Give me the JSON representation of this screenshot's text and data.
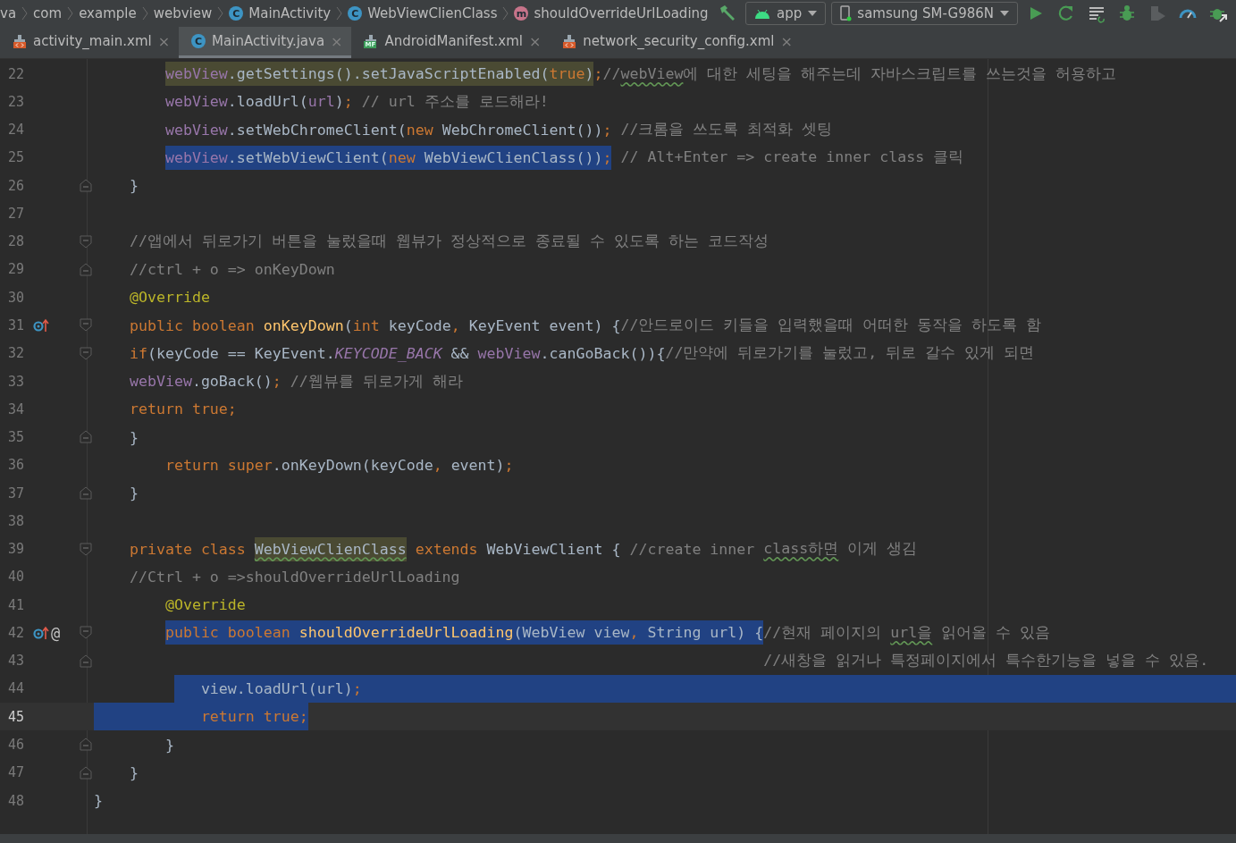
{
  "breadcrumbs": [
    {
      "label": "va",
      "kind": "package"
    },
    {
      "label": "com",
      "kind": "package"
    },
    {
      "label": "example",
      "kind": "package"
    },
    {
      "label": "webview",
      "kind": "package"
    },
    {
      "label": "MainActivity",
      "kind": "class",
      "badge": "C"
    },
    {
      "label": "WebViewClienClass",
      "kind": "class",
      "badge": "C"
    },
    {
      "label": "shouldOverrideUrlLoading",
      "kind": "method",
      "badge": "m"
    }
  ],
  "toolbar": {
    "run_config": "app",
    "device": "samsung SM-G986N"
  },
  "tabs": [
    {
      "label": "activity_main.xml",
      "kind": "layout",
      "selected": false,
      "close": "×"
    },
    {
      "label": "MainActivity.java",
      "kind": "class",
      "badge": "C",
      "selected": true,
      "close": "×"
    },
    {
      "label": "AndroidManifest.xml",
      "kind": "manifest",
      "badge": "MF",
      "selected": false,
      "close": "×"
    },
    {
      "label": "network_security_config.xml",
      "kind": "layout",
      "selected": false,
      "close": "×"
    }
  ],
  "lines": [
    {
      "num": "22",
      "current": false,
      "indent": {
        "kind": "method"
      },
      "kind": "plain",
      "tokens": [
        {
          "t": "webView",
          "kind": "field",
          "hl": true
        },
        {
          "t": ".getSettings().setJavaScriptEnabled(",
          "kind": "plain",
          "hl": true
        },
        {
          "t": "true",
          "kind": "kw",
          "hl": true
        },
        {
          "t": ")",
          "kind": "plain",
          "hl": true
        },
        {
          "t": ";",
          "kind": "kw"
        },
        {
          "t": "//",
          "kind": "comment"
        },
        {
          "t": "webView",
          "kind": "comment",
          "typo": true
        },
        {
          "t": "에 대한 세팅을 해주는데 자바스크립트를 쓰는것을 허용하고",
          "kind": "comment"
        }
      ]
    },
    {
      "num": "23",
      "current": false,
      "indent": {
        "kind": "method"
      },
      "kind": "plain",
      "tokens": [
        {
          "t": "webView",
          "kind": "field"
        },
        {
          "t": ".loadUrl(",
          "kind": "plain"
        },
        {
          "t": "url",
          "kind": "field"
        },
        {
          "t": ")",
          "kind": "plain"
        },
        {
          "t": ";",
          "kind": "kw"
        },
        {
          "t": " // url 주소를 로드해라!",
          "kind": "comment"
        }
      ]
    },
    {
      "num": "24",
      "current": false,
      "indent": {
        "kind": "method"
      },
      "kind": "plain",
      "tokens": [
        {
          "t": "webView",
          "kind": "field"
        },
        {
          "t": ".setWebChromeClient(",
          "kind": "plain"
        },
        {
          "t": "new",
          "kind": "kw"
        },
        {
          "t": " WebChromeClient())",
          "kind": "plain"
        },
        {
          "t": ";",
          "kind": "kw"
        },
        {
          "t": " //크롬을 쓰도록 최적화 셋팅",
          "kind": "comment"
        }
      ]
    },
    {
      "num": "25",
      "current": false,
      "indent": {
        "kind": "method"
      },
      "kind": "partial-selection",
      "tokens": [
        {
          "t": "webView",
          "kind": "field",
          "selected": true
        },
        {
          "t": ".setWebViewClient(",
          "kind": "plain",
          "selected": true
        },
        {
          "t": "new",
          "kind": "kw",
          "selected": true
        },
        {
          "t": " WebViewClienClass())",
          "kind": "plain",
          "selected": true
        },
        {
          "t": ";",
          "kind": "kw",
          "selected": true
        },
        {
          "t": " // Alt+Enter => create inner class 클릭",
          "kind": "comment",
          "selected": false
        }
      ]
    },
    {
      "num": "26",
      "current": false,
      "fold_end": true,
      "indent": {
        "kind": "class"
      },
      "kind": "plain",
      "tokens": [
        {
          "t": "}",
          "kind": "plain"
        }
      ]
    },
    {
      "num": "27",
      "current": false,
      "kind": "plain"
    },
    {
      "num": "28",
      "current": false,
      "fold_start": true,
      "indent": {
        "kind": "class"
      },
      "kind": "plain",
      "tokens": [
        {
          "t": "//앱에서 뒤로가기 버튼을 눌렀을때 웹뷰가 정상적으로 종료될 수 있도록 하는 코드작성",
          "kind": "comment"
        }
      ]
    },
    {
      "num": "29",
      "current": false,
      "fold_end": true,
      "indent": {
        "kind": "class"
      },
      "kind": "plain",
      "tokens": [
        {
          "t": "//ctrl + o => onKeyDown",
          "kind": "comment"
        }
      ]
    },
    {
      "num": "30",
      "current": false,
      "indent": {
        "kind": "class"
      },
      "kind": "plain",
      "tokens": [
        {
          "t": "@Override",
          "kind": "annot"
        }
      ]
    },
    {
      "num": "31",
      "current": false,
      "override": true,
      "fold_start": true,
      "indent": {
        "kind": "class"
      },
      "kind": "plain",
      "tokens": [
        {
          "t": "public boolean ",
          "kind": "kw"
        },
        {
          "t": "onKeyDown",
          "kind": "method"
        },
        {
          "t": "(",
          "kind": "plain"
        },
        {
          "t": "int",
          "kind": "kw"
        },
        {
          "t": " keyCode",
          "kind": "plain"
        },
        {
          "t": ",",
          "kind": "kw"
        },
        {
          "t": " KeyEvent event) {",
          "kind": "plain"
        },
        {
          "t": "//안드로이드 키들을 입력했을때 어떠한 동작을 하도록 함",
          "kind": "comment"
        }
      ]
    },
    {
      "num": "32",
      "current": false,
      "fold_start": true,
      "indent": {
        "kind": "class"
      },
      "kind": "plain",
      "tokens": [
        {
          "t": "if",
          "kind": "kw"
        },
        {
          "t": "(keyCode == KeyEvent.",
          "kind": "plain"
        },
        {
          "t": "KEYCODE_BACK",
          "kind": "static"
        },
        {
          "t": " && ",
          "kind": "plain"
        },
        {
          "t": "webView",
          "kind": "field"
        },
        {
          "t": ".canGoBack()){",
          "kind": "plain"
        },
        {
          "t": "//만약에 뒤로가기를 눌렀고, 뒤로 갈수 있게 되면",
          "kind": "comment"
        }
      ]
    },
    {
      "num": "33",
      "current": false,
      "indent": {
        "kind": "class"
      },
      "kind": "plain",
      "tokens": [
        {
          "t": "webView",
          "kind": "field"
        },
        {
          "t": ".goBack()",
          "kind": "plain"
        },
        {
          "t": ";",
          "kind": "kw"
        },
        {
          "t": " //웹뷰를 뒤로가게 해라",
          "kind": "comment"
        }
      ]
    },
    {
      "num": "34",
      "current": false,
      "indent": {
        "kind": "class"
      },
      "kind": "plain",
      "tokens": [
        {
          "t": "return true;",
          "kind": "kw"
        }
      ]
    },
    {
      "num": "35",
      "current": false,
      "fold_end": true,
      "indent": {
        "kind": "class"
      },
      "kind": "plain",
      "tokens": [
        {
          "t": "}",
          "kind": "plain"
        }
      ]
    },
    {
      "num": "36",
      "current": false,
      "indent": {
        "kind": "method"
      },
      "kind": "plain",
      "tokens": [
        {
          "t": "return super",
          "kind": "kw"
        },
        {
          "t": ".onKeyDown(keyCode",
          "kind": "plain"
        },
        {
          "t": ",",
          "kind": "kw"
        },
        {
          "t": " event)",
          "kind": "plain"
        },
        {
          "t": ";",
          "kind": "kw"
        }
      ]
    },
    {
      "num": "37",
      "current": false,
      "fold_end": true,
      "indent": {
        "kind": "class"
      },
      "kind": "plain",
      "tokens": [
        {
          "t": "}",
          "kind": "plain"
        }
      ]
    },
    {
      "num": "38",
      "current": false,
      "kind": "plain"
    },
    {
      "num": "39",
      "current": false,
      "fold_start": true,
      "indent": {
        "kind": "class"
      },
      "kind": "plain",
      "tokens": [
        {
          "t": "private class ",
          "kind": "kw"
        },
        {
          "t": "WebViewClienClass",
          "kind": "plain",
          "hl": true,
          "typo": true
        },
        {
          "t": " extends ",
          "kind": "kw"
        },
        {
          "t": "WebViewClient { ",
          "kind": "plain"
        },
        {
          "t": "//create inner ",
          "kind": "comment"
        },
        {
          "t": "class하면",
          "kind": "comment",
          "typo": true
        },
        {
          "t": " 이게 생김",
          "kind": "comment"
        }
      ]
    },
    {
      "num": "40",
      "current": false,
      "indent": {
        "kind": "class"
      },
      "kind": "plain",
      "tokens": [
        {
          "t": "//Ctrl + o =>shouldOverrideUrlLoading",
          "kind": "comment"
        }
      ]
    },
    {
      "num": "41",
      "current": false,
      "indent": {
        "kind": "method"
      },
      "kind": "plain",
      "tokens": [
        {
          "t": "@Override",
          "kind": "annot"
        }
      ]
    },
    {
      "num": "42",
      "current": false,
      "override": true,
      "gutter_text": "@",
      "fold_start": true,
      "indent": {
        "kind": "method"
      },
      "kind": "partial-selection",
      "tokens": [
        {
          "t": "public boolean ",
          "kind": "kw",
          "selected": true
        },
        {
          "t": "shouldOverrideUrlLoading",
          "kind": "method",
          "selected": true
        },
        {
          "t": "(WebView view",
          "kind": "plain",
          "selected": true
        },
        {
          "t": ",",
          "kind": "kw",
          "selected": true
        },
        {
          "t": " String url) {",
          "kind": "plain",
          "selected": true
        },
        {
          "t": "//현재 페이지의 ",
          "kind": "comment",
          "selected": false
        },
        {
          "t": "url을",
          "kind": "comment",
          "typo": true,
          "selected": false
        },
        {
          "t": " 읽어올 수 있음",
          "kind": "comment",
          "selected": false
        }
      ]
    },
    {
      "num": "43",
      "current": false,
      "fold_end": true,
      "indent": {
        "kind": "aligned"
      },
      "kind": "plain",
      "tokens": [
        {
          "t": "//새창을 읽거나 특정페이지에서 특수한기능을 넣을 수 있음.",
          "kind": "comment"
        }
      ]
    },
    {
      "num": "44",
      "current": false,
      "indent": {
        "kind": "statement"
      },
      "kind": "selection-to-end",
      "tokens": [
        {
          "t": "view.loadUrl(url)",
          "kind": "plain"
        },
        {
          "t": ";",
          "kind": "kw"
        }
      ]
    },
    {
      "num": "45",
      "current": true,
      "indent": {
        "kind": "statement"
      },
      "kind": "selection-from-edge",
      "tokens": [
        {
          "t": "return true;",
          "kind": "kw"
        }
      ]
    },
    {
      "num": "46",
      "current": false,
      "fold_end": true,
      "indent": {
        "kind": "method"
      },
      "kind": "plain",
      "tokens": [
        {
          "t": "}",
          "kind": "plain"
        }
      ]
    },
    {
      "num": "47",
      "current": false,
      "fold_end": true,
      "indent": {
        "kind": "class"
      },
      "kind": "plain",
      "tokens": [
        {
          "t": "}",
          "kind": "plain"
        }
      ]
    },
    {
      "num": "48",
      "current": false,
      "kind": "plain",
      "tokens": [
        {
          "t": "}",
          "kind": "plain"
        }
      ]
    }
  ]
}
